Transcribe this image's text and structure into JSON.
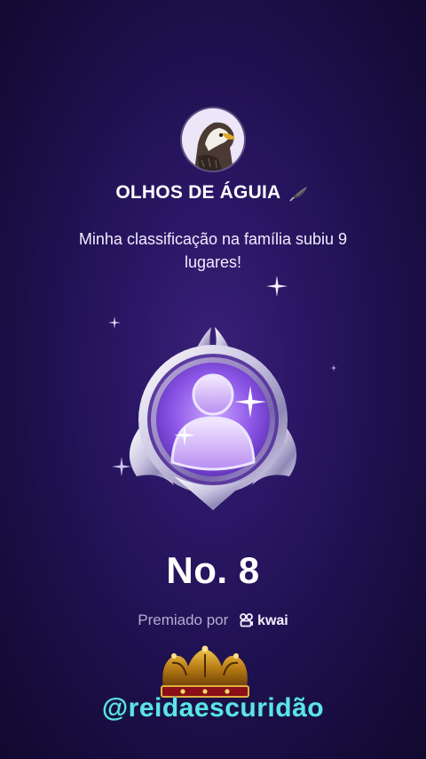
{
  "profile": {
    "name": "OLHOS DE ÁGUIA",
    "title_icon": "eagle-feather-icon",
    "avatar_icon": "eagle-avatar"
  },
  "message": "Minha classificação na família subiu 9 lugares!",
  "medal_icon": "family-rank-medal",
  "rank": "No. 8",
  "awarded": {
    "label": "Premiado por",
    "brand": "kwai",
    "brand_icon": "kwai-logo-icon"
  },
  "watermark": {
    "handle": "@reidaescuridão",
    "crown_icon": "crown-icon"
  },
  "colors": {
    "background": "#1f1150",
    "handle": "#5fe3e9",
    "awarded_label": "#b5acd1"
  }
}
